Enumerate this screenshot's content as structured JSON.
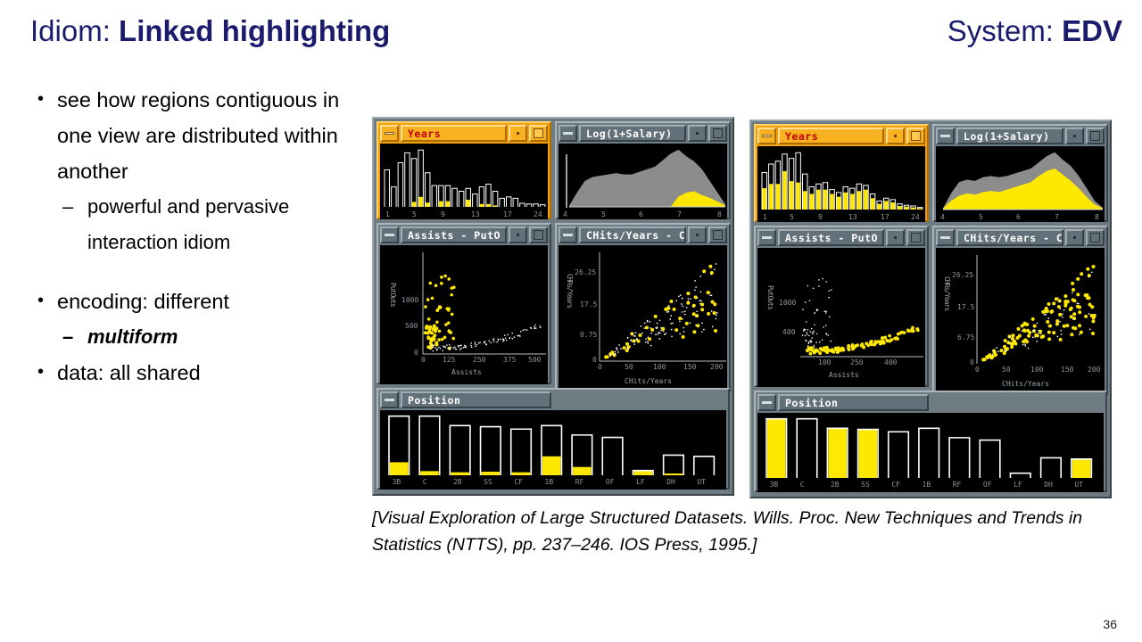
{
  "slide": {
    "title_plain": "Idiom: ",
    "title_bold": "Linked highlighting",
    "system_plain": "System: ",
    "system_bold": "EDV",
    "page_number": "36",
    "citation": "[Visual Exploration of Large Structured Datasets. Wills. Proc. New Techniques and Trends in Statistics (NTTS), pp. 237–246. IOS Press, 1995.]",
    "title_color": "#1b1b6e"
  },
  "bullets": [
    {
      "level": 1,
      "text": "see how regions contiguous in one view are distributed within another"
    },
    {
      "level": 2,
      "text": "powerful and pervasive interaction idiom"
    },
    {
      "level": 1,
      "text": "encoding: different"
    },
    {
      "level": 2,
      "text": "multiform",
      "style": "bold-italic"
    },
    {
      "level": 1,
      "text": "data: all shared"
    }
  ],
  "colors": {
    "highlight_yellow": "#ffe800",
    "active_title_bg": "#f8b221",
    "active_title_text": "#c00000",
    "inactive_title_bg": "#62707a",
    "inactive_title_text": "#ffffff",
    "desktop_bg": "#6e7b82",
    "canvas_bg": "#000000",
    "area_gray": "#8c8c8c",
    "outline_white": "#ffffff"
  },
  "panels": [
    {
      "id": "panel-left",
      "caption": "left-screenshot",
      "windows": [
        {
          "name": "years-window",
          "title": "Years",
          "active": true,
          "buttons": [
            "minimize",
            "restore",
            "maximize"
          ],
          "chart": {
            "type": "bar",
            "title": "Years",
            "xlabel": "",
            "ylabel": "",
            "categories": [
              "1",
              "2",
              "3",
              "4",
              "5",
              "6",
              "7",
              "8",
              "9",
              "10",
              "11",
              "12",
              "13",
              "14",
              "15",
              "16",
              "17",
              "18",
              "19",
              "20",
              "21",
              "22",
              "23",
              "24"
            ],
            "tick_labels": [
              "1",
              "5",
              "9",
              "13",
              "17",
              "24"
            ],
            "values": [
              52,
              28,
              62,
              76,
              68,
              80,
              48,
              30,
              30,
              30,
              26,
              22,
              26,
              18,
              28,
              32,
              22,
              12,
              14,
              12,
              5,
              4,
              4,
              3
            ],
            "highlight_values": [
              0,
              0,
              0,
              0,
              7,
              14,
              6,
              0,
              8,
              8,
              0,
              0,
              10,
              0,
              4,
              4,
              2,
              0,
              0,
              0,
              0,
              0,
              0,
              0
            ],
            "ylim": [
              0,
              84
            ]
          }
        },
        {
          "name": "salary-window",
          "title": "Log(1+Salary)",
          "active": false,
          "buttons": [
            "minimize",
            "restore",
            "maximize"
          ],
          "chart": {
            "type": "area",
            "title": "Log(1+Salary)",
            "xlabel": "",
            "tick_labels": [
              "4",
              "5",
              "6",
              "7",
              "8"
            ],
            "x": [
              4.0,
              4.2,
              4.4,
              4.6,
              4.8,
              5.0,
              5.2,
              5.4,
              5.6,
              5.8,
              6.0,
              6.2,
              6.4,
              6.6,
              6.8,
              7.0,
              7.2,
              7.4,
              7.6,
              7.8,
              8.0
            ],
            "total": [
              2,
              22,
              40,
              46,
              48,
              50,
              52,
              50,
              50,
              54,
              58,
              62,
              72,
              82,
              88,
              78,
              70,
              58,
              40,
              22,
              4
            ],
            "highlight": [
              0,
              0,
              0,
              0,
              0,
              0,
              0,
              0,
              0,
              0,
              0,
              0,
              0,
              0,
              16,
              22,
              24,
              18,
              14,
              8,
              2
            ],
            "ylim": [
              0,
              92
            ]
          }
        },
        {
          "name": "assists-putouts-window",
          "title": "Assists    - PutO",
          "active": false,
          "buttons": [
            "minimize",
            "restore",
            "maximize"
          ],
          "chart": {
            "type": "scatter",
            "xlabel": "Assists",
            "ylabel": "PutOuts",
            "x_ticks": [
              "0",
              "125",
              "250",
              "375",
              "500"
            ],
            "y_ticks": [
              "0",
              "500",
              "1000"
            ],
            "xlim": [
              0,
              560
            ],
            "ylim": [
              0,
              1400
            ]
          }
        },
        {
          "name": "chits-years-window",
          "title": "CHits/Years   - C",
          "active": false,
          "buttons": [
            "minimize",
            "restore",
            "maximize"
          ],
          "chart": {
            "type": "scatter",
            "xlabel": "CHits/Years",
            "ylabel": "CHRs/Years",
            "x_ticks": [
              "0",
              "50",
              "100",
              "150",
              "200"
            ],
            "y_ticks": [
              "0",
              "0.75",
              "17.5",
              "26.25"
            ],
            "xlim": [
              0,
              215
            ],
            "ylim": [
              0,
              30
            ]
          }
        },
        {
          "name": "position-window",
          "title": "Position",
          "active": false,
          "buttons": [
            "minimize"
          ],
          "chart": {
            "type": "bar",
            "xlabel": "",
            "categories": [
              "3B",
              "C",
              "2B",
              "SS",
              "CF",
              "1B",
              "RF",
              "OF",
              "LF",
              "DH",
              "UT"
            ],
            "values": [
              100,
              100,
              84,
              82,
              78,
              84,
              68,
              64,
              8,
              34,
              32
            ],
            "highlight_values": [
              22,
              7,
              5,
              6,
              5,
              32,
              14,
              0,
              8,
              3,
              0
            ],
            "ylim": [
              0,
              104
            ]
          }
        }
      ]
    },
    {
      "id": "panel-right",
      "caption": "right-screenshot",
      "windows": [
        {
          "name": "years-window",
          "title": "Years",
          "active": true,
          "buttons": [
            "minimize",
            "restore",
            "maximize"
          ],
          "chart": {
            "type": "bar",
            "title": "Years",
            "tick_labels": [
              "1",
              "5",
              "9",
              "13",
              "17",
              "24"
            ],
            "categories": [
              "1",
              "2",
              "3",
              "4",
              "5",
              "6",
              "7",
              "8",
              "9",
              "10",
              "11",
              "12",
              "13",
              "14",
              "15",
              "16",
              "17",
              "18",
              "19",
              "20",
              "21",
              "22",
              "23",
              "24"
            ],
            "values": [
              52,
              64,
              68,
              78,
              72,
              80,
              50,
              32,
              36,
              38,
              28,
              24,
              32,
              30,
              36,
              34,
              22,
              12,
              16,
              14,
              8,
              6,
              5,
              3
            ],
            "highlight_values": [
              30,
              36,
              36,
              54,
              40,
              38,
              26,
              22,
              28,
              28,
              22,
              18,
              24,
              22,
              26,
              28,
              16,
              8,
              12,
              10,
              5,
              4,
              3,
              2
            ],
            "ylim": [
              0,
              84
            ]
          }
        },
        {
          "name": "salary-window",
          "title": "Log(1+Salary)",
          "active": false,
          "buttons": [
            "minimize",
            "restore",
            "maximize"
          ],
          "chart": {
            "type": "area",
            "tick_labels": [
              "4",
              "5",
              "6",
              "7",
              "8"
            ],
            "x": [
              4.0,
              4.2,
              4.4,
              4.6,
              4.8,
              5.0,
              5.2,
              5.4,
              5.6,
              5.8,
              6.0,
              6.2,
              6.4,
              6.6,
              6.8,
              7.0,
              7.2,
              7.4,
              7.6,
              7.8,
              8.0
            ],
            "total": [
              2,
              26,
              44,
              48,
              46,
              52,
              54,
              52,
              54,
              58,
              62,
              66,
              76,
              86,
              92,
              80,
              70,
              54,
              34,
              14,
              3
            ],
            "highlight": [
              2,
              14,
              22,
              26,
              24,
              28,
              30,
              28,
              32,
              36,
              40,
              44,
              54,
              62,
              66,
              56,
              46,
              34,
              20,
              8,
              2
            ],
            "ylim": [
              0,
              96
            ]
          }
        },
        {
          "name": "assists-putouts-window",
          "title": "Assists    - PutO",
          "active": false,
          "buttons": [
            "minimize",
            "restore",
            "maximize"
          ],
          "chart": {
            "type": "scatter",
            "xlabel": "Assists",
            "ylabel": "PutOuts",
            "x_ticks": [
              "100",
              "250",
              "400"
            ],
            "y_ticks": [
              "400",
              "1000"
            ],
            "xlim": [
              0,
              560
            ],
            "ylim": [
              0,
              1400
            ]
          }
        },
        {
          "name": "chits-years-window",
          "title": "CHits/Years   - C",
          "active": false,
          "buttons": [
            "minimize",
            "restore",
            "maximize"
          ],
          "chart": {
            "type": "scatter",
            "xlabel": "CHits/Years",
            "ylabel": "CHRs/Years",
            "x_ticks": [
              "0",
              "50",
              "100",
              "150",
              "200"
            ],
            "y_ticks": [
              "0",
              "6.75",
              "17.5",
              "26.25"
            ],
            "xlim": [
              0,
              215
            ],
            "ylim": [
              0,
              30
            ]
          }
        },
        {
          "name": "position-window",
          "title": "Position",
          "active": false,
          "buttons": [
            "minimize"
          ],
          "chart": {
            "type": "bar",
            "categories": [
              "3B",
              "C",
              "2B",
              "SS",
              "CF",
              "1B",
              "RF",
              "OF",
              "LF",
              "DH",
              "UT"
            ],
            "values": [
              100,
              100,
              84,
              82,
              78,
              84,
              68,
              64,
              8,
              34,
              32
            ],
            "highlight_values": [
              100,
              0,
              84,
              82,
              0,
              0,
              0,
              0,
              0,
              0,
              32
            ],
            "ylim": [
              0,
              104
            ]
          }
        }
      ]
    }
  ]
}
